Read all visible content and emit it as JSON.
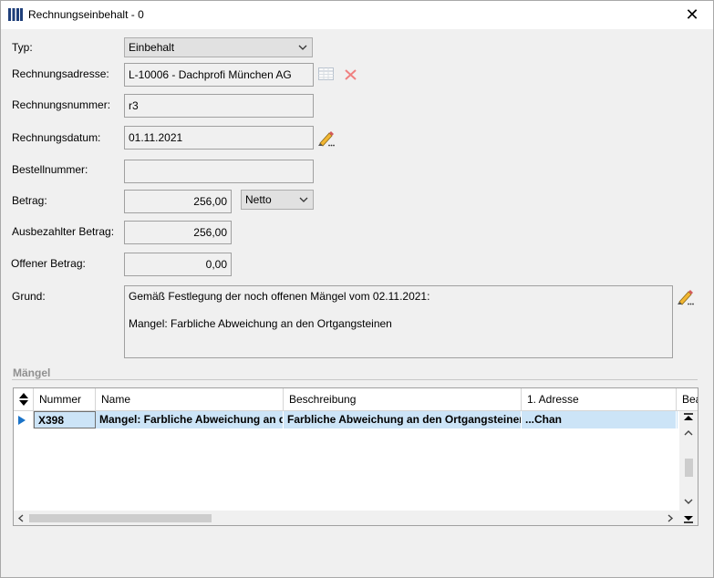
{
  "window": {
    "title": "Rechnungseinbehalt - 0",
    "close_glyph": "✕"
  },
  "form": {
    "typ": {
      "label": "Typ:",
      "value": "Einbehalt"
    },
    "rechnungsadresse": {
      "label": "Rechnungsadresse:",
      "value": "L-10006 - Dachprofi München AG"
    },
    "rechnungsnummer": {
      "label": "Rechnungsnummer:",
      "value": "r3"
    },
    "rechnungsdatum": {
      "label": "Rechnungsdatum:",
      "value": "01.11.2021"
    },
    "bestellnummer": {
      "label": "Bestellnummer:",
      "value": ""
    },
    "betrag": {
      "label": "Betrag:",
      "value": "256,00",
      "mode": "Netto"
    },
    "ausbezahlter_betrag": {
      "label": "Ausbezahlter Betrag:",
      "value": "256,00"
    },
    "offener_betrag": {
      "label": "Offener Betrag:",
      "value": "0,00"
    },
    "grund": {
      "label": "Grund:",
      "value": "Gemäß Festlegung der noch offenen Mängel vom 02.11.2021:\n\nMangel: Farbliche Abweichung an den Ortgangsteinen"
    }
  },
  "maengel": {
    "title": "Mängel",
    "columns": [
      "Nummer",
      "Name",
      "Beschreibung",
      "1. Adresse",
      "Bea"
    ],
    "rows": [
      {
        "nummer": "X398",
        "name": "Mangel: Farbliche Abweichung an de",
        "beschreibung": "Farbliche Abweichung an den Ortgangsteinen",
        "adresse": "...Chan"
      }
    ]
  },
  "colors": {
    "selection": "#cce4f7",
    "accent": "#0078d7",
    "delete_icon": "#e05050"
  }
}
